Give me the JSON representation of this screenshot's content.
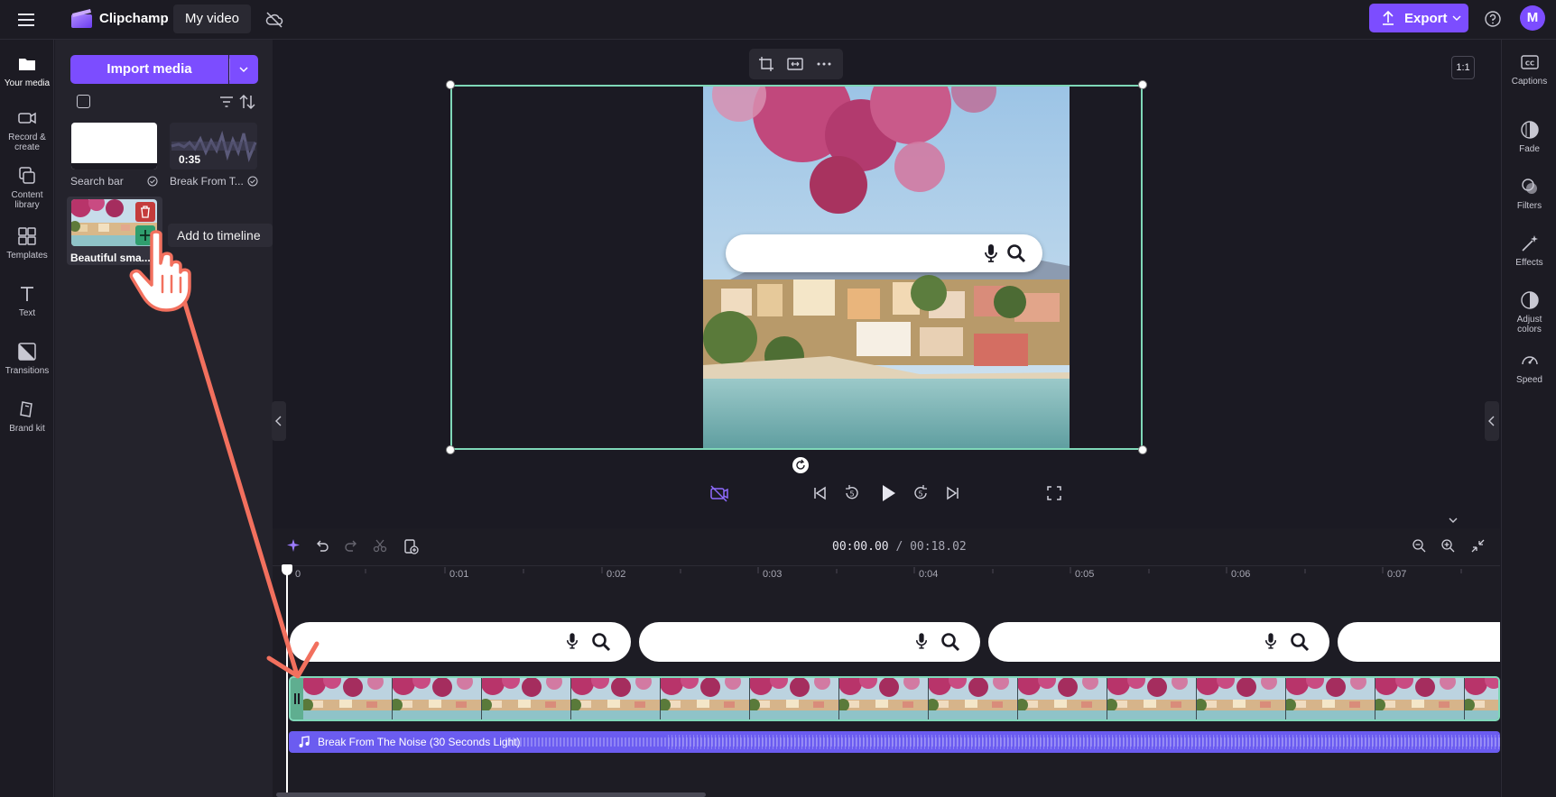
{
  "topbar": {
    "app_name": "Clipchamp",
    "project_name": "My video",
    "export_label": "Export",
    "avatar_initial": "M"
  },
  "left_rail": {
    "items": [
      {
        "label_1": "Your media",
        "label_2": "",
        "icon": "folder-icon",
        "active": true
      },
      {
        "label_1": "Record &",
        "label_2": "create",
        "icon": "camera-icon",
        "active": false
      },
      {
        "label_1": "Content",
        "label_2": "library",
        "icon": "library-icon",
        "active": false
      },
      {
        "label_1": "Templates",
        "label_2": "",
        "icon": "templates-icon",
        "active": false
      },
      {
        "label_1": "Text",
        "label_2": "",
        "icon": "text-icon",
        "active": false
      },
      {
        "label_1": "Transitions",
        "label_2": "",
        "icon": "transitions-icon",
        "active": false
      },
      {
        "label_1": "Brand kit",
        "label_2": "",
        "icon": "brand-kit-icon",
        "active": false
      }
    ]
  },
  "media_panel": {
    "import_label": "Import media",
    "items": [
      {
        "caption": "Search bar",
        "type": "image"
      },
      {
        "caption": "Break From T...",
        "type": "audio",
        "duration": "0:35"
      },
      {
        "caption": "Beautiful sma...",
        "type": "video"
      }
    ],
    "tooltip": "Add to timeline"
  },
  "preview": {
    "aspect_ratio": "1:1"
  },
  "timeline": {
    "current_time": "00:00.00",
    "total_time": "/ 00:18.02",
    "ruler": [
      "0",
      "0:01",
      "0:02",
      "0:03",
      "0:04",
      "0:05",
      "0:06",
      "0:07"
    ],
    "audio_track_label": "Break From The Noise (30 Seconds Light)"
  },
  "right_rail": {
    "items": [
      {
        "label_1": "Captions",
        "label_2": "",
        "icon": "captions-icon"
      },
      {
        "label_1": "Fade",
        "label_2": "",
        "icon": "fade-icon"
      },
      {
        "label_1": "Filters",
        "label_2": "",
        "icon": "filters-icon"
      },
      {
        "label_1": "Effects",
        "label_2": "",
        "icon": "effects-icon"
      },
      {
        "label_1": "Adjust",
        "label_2": "colors",
        "icon": "adjust-colors-icon"
      },
      {
        "label_1": "Speed",
        "label_2": "",
        "icon": "speed-icon"
      }
    ]
  },
  "colors": {
    "accent": "#7c4dff",
    "selection": "#7fd8b8",
    "audio_track": "#6b5cf0",
    "arrow": "#f2705e"
  }
}
